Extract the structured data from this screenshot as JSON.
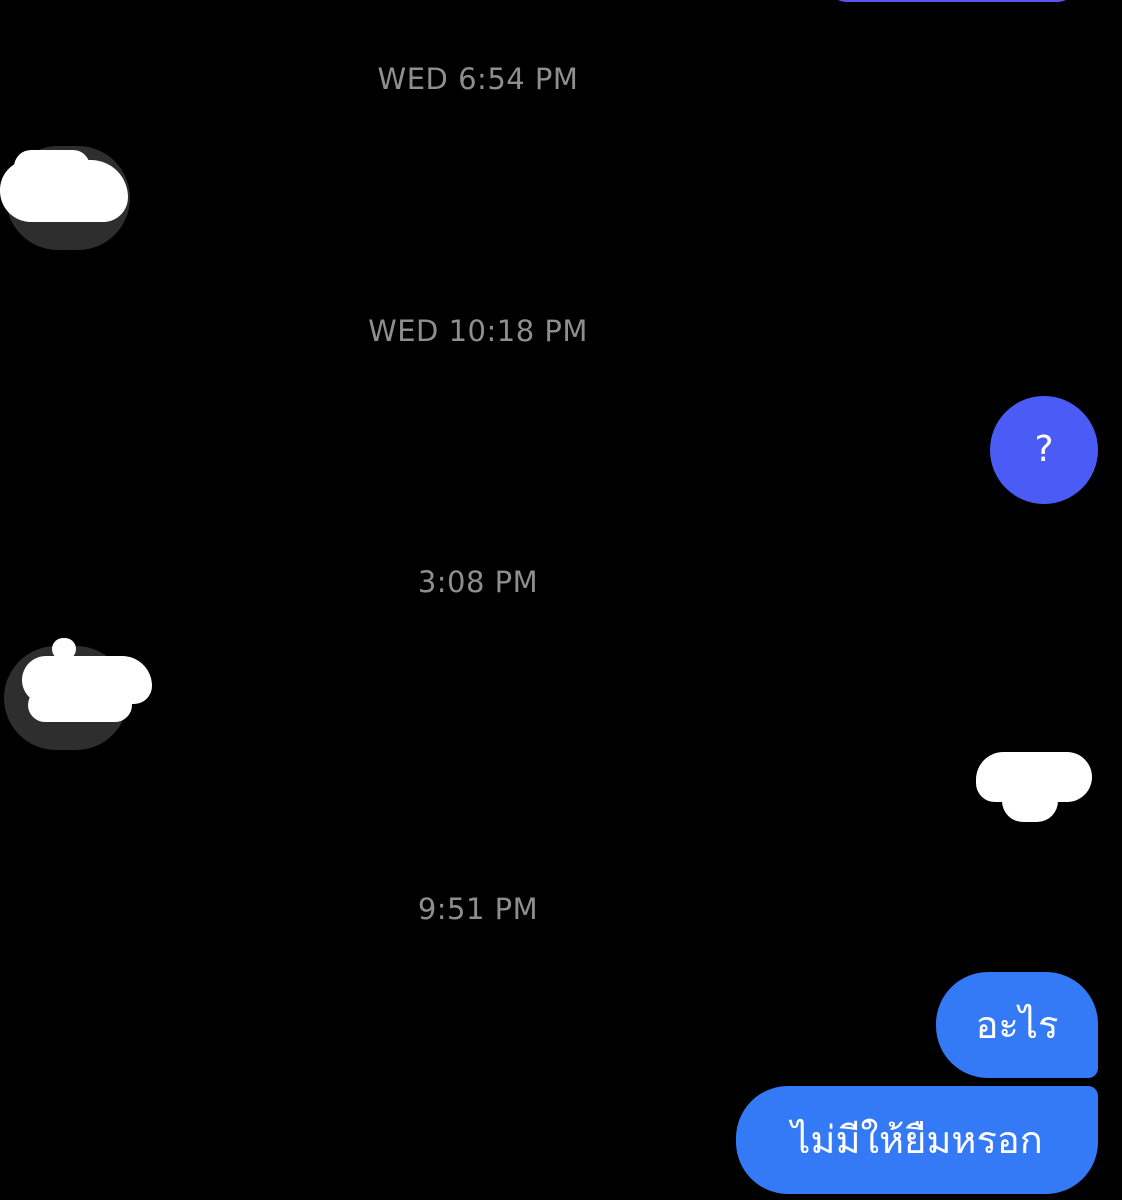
{
  "conversation": {
    "timestamps": [
      "WED 6:54 PM",
      "WED 10:18 PM",
      "3:08 PM",
      "9:51 PM"
    ],
    "messages": [
      {
        "side": "right",
        "text": "?"
      },
      {
        "side": "right",
        "text": "อะไร"
      },
      {
        "side": "right",
        "text": "ไม่มีให้ยืมหรอก"
      }
    ]
  },
  "colors": {
    "background": "#000000",
    "sent_bubble": "#3479f6",
    "sent_bubble_round": "#4a5cf5",
    "timestamp_text": "#8e8e8e"
  }
}
